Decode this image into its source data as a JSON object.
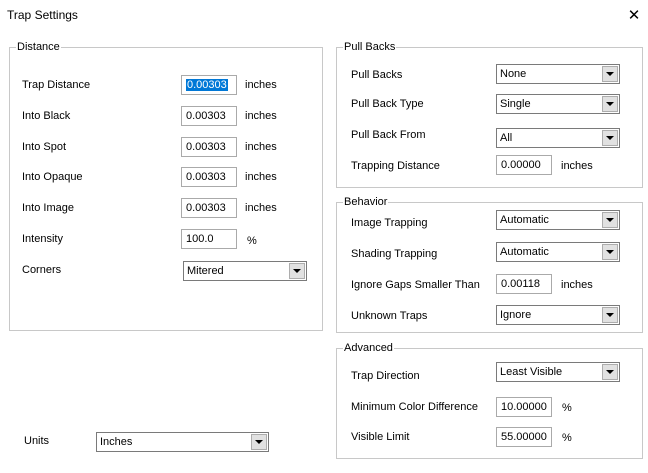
{
  "window": {
    "title": "Trap Settings"
  },
  "distance": {
    "title": "Distance",
    "rows": [
      {
        "label": "Trap Distance",
        "value": "0.00303",
        "unit": "inches"
      },
      {
        "label": "Into Black",
        "value": "0.00303",
        "unit": "inches"
      },
      {
        "label": "Into Spot",
        "value": "0.00303",
        "unit": "inches"
      },
      {
        "label": "Into Opaque",
        "value": "0.00303",
        "unit": "inches"
      },
      {
        "label": "Into Image",
        "value": "0.00303",
        "unit": "inches"
      },
      {
        "label": "Intensity",
        "value": "100.0",
        "unit": "%"
      }
    ],
    "corners": {
      "label": "Corners",
      "value": "Mitered"
    }
  },
  "pullbacks": {
    "title": "Pull Backs",
    "pull_backs": {
      "label": "Pull Backs",
      "value": "None"
    },
    "pull_back_type": {
      "label": "Pull Back Type",
      "value": "Single"
    },
    "pull_back_from": {
      "label": "Pull Back From",
      "value": "All"
    },
    "trapping_distance": {
      "label": "Trapping Distance",
      "value": "0.00000",
      "unit": "inches"
    }
  },
  "behavior": {
    "title": "Behavior",
    "image_trapping": {
      "label": "Image Trapping",
      "value": "Automatic"
    },
    "shading_trapping": {
      "label": "Shading Trapping",
      "value": "Automatic"
    },
    "ignore_gaps": {
      "label": "Ignore Gaps Smaller Than",
      "value": "0.00118",
      "unit": "inches"
    },
    "unknown_traps": {
      "label": "Unknown Traps",
      "value": "Ignore"
    }
  },
  "advanced": {
    "title": "Advanced",
    "trap_direction": {
      "label": "Trap Direction",
      "value": "Least Visible"
    },
    "min_color_diff": {
      "label": "Minimum Color Difference",
      "value": "10.00000",
      "unit": "%"
    },
    "visible_limit": {
      "label": "Visible Limit",
      "value": "55.00000",
      "unit": "%"
    }
  },
  "units": {
    "label": "Units",
    "value": "Inches"
  }
}
